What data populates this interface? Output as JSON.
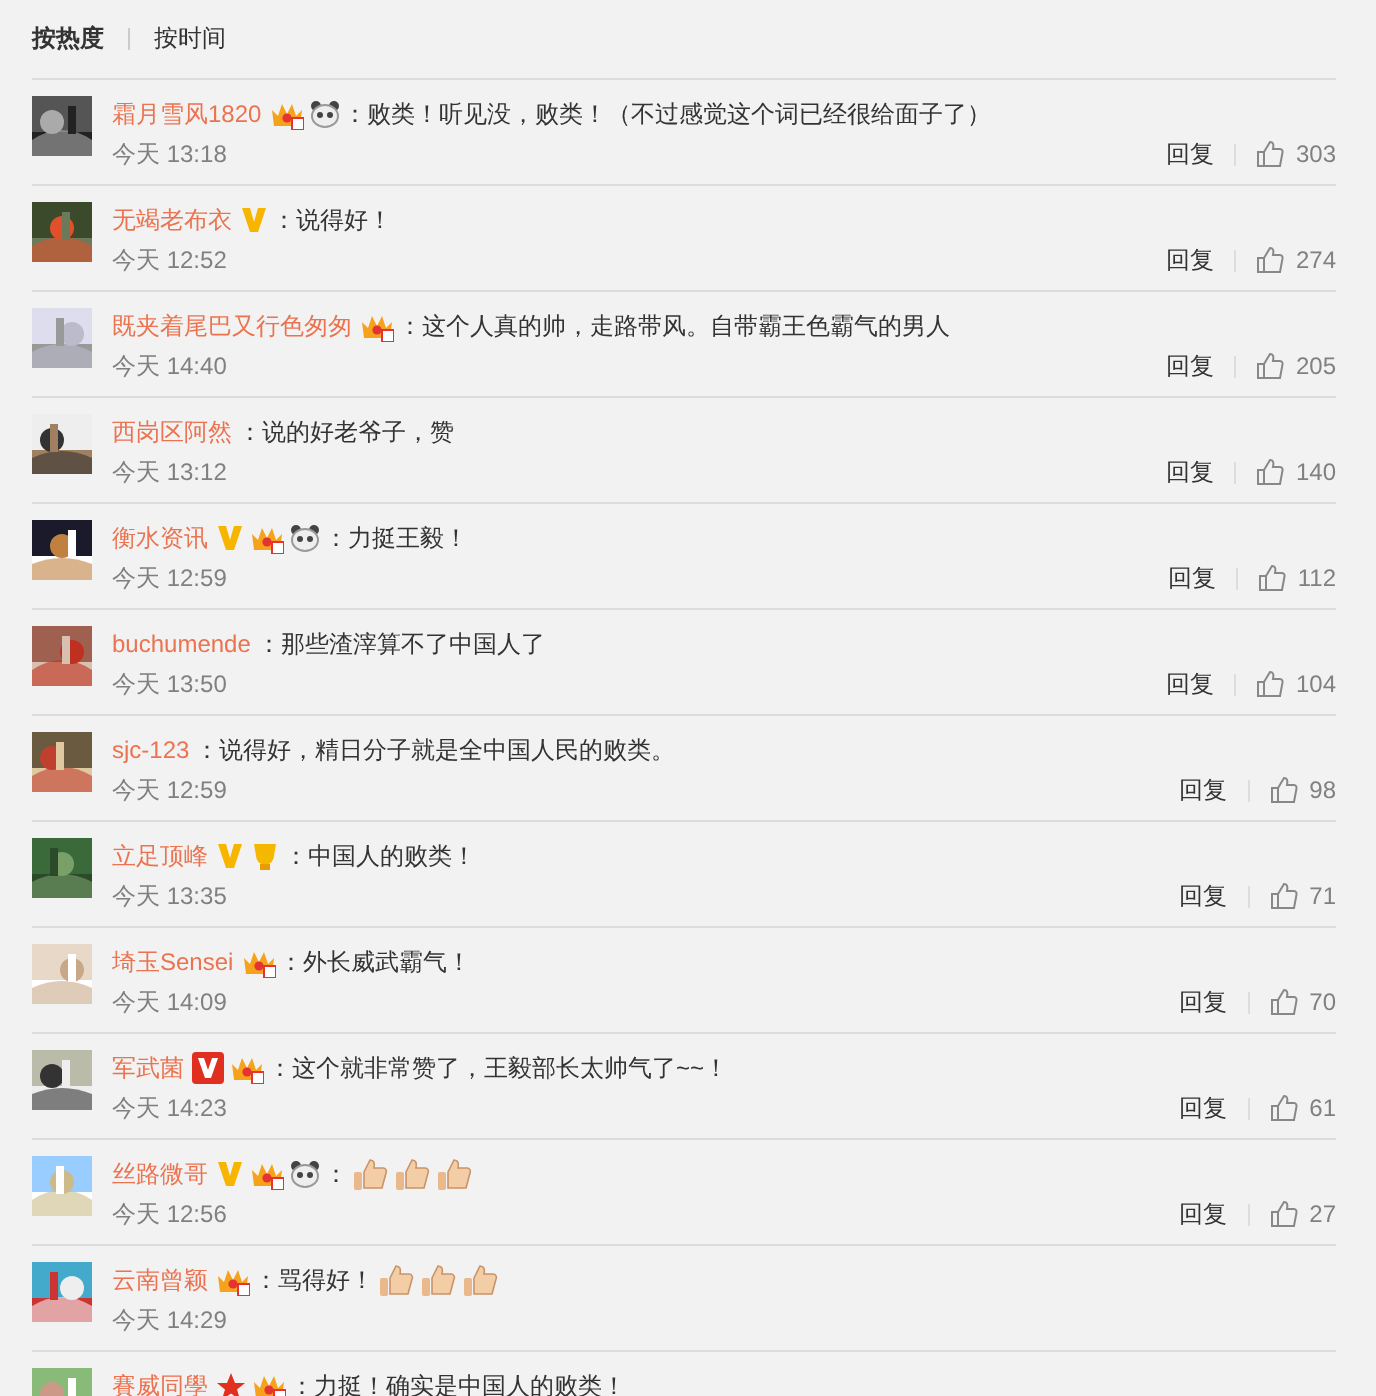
{
  "sort_tabs": [
    {
      "label": "按热度",
      "selected": true
    },
    {
      "label": "按时间",
      "selected": false
    }
  ],
  "comments": [
    {
      "name": "霜月雪风1820",
      "badges": [
        {
          "kind": "crown"
        },
        {
          "kind": "panda"
        }
      ],
      "text": "：败类！听见没，败类！（不过感觉这个词已经很给面子了）",
      "time": "今天 13:18",
      "reply": "回复",
      "likes": "303"
    },
    {
      "name": "无竭老布衣",
      "badges": [
        {
          "kind": "verified"
        }
      ],
      "text": "：说得好！",
      "time": "今天 12:52",
      "reply": "回复",
      "likes": "274"
    },
    {
      "name": "既夹着尾巴又行色匆匆",
      "badges": [
        {
          "kind": "crown"
        }
      ],
      "text": "：这个人真的帅，走路带风。自带霸王色霸气的男人",
      "time": "今天 14:40",
      "reply": "回复",
      "likes": "205"
    },
    {
      "name": "西岗区阿然",
      "text": "：说的好老爷子，赞",
      "time": "今天 13:12",
      "reply": "回复",
      "likes": "140"
    },
    {
      "name": "衡水资讯",
      "badges": [
        {
          "kind": "verified"
        },
        {
          "kind": "crown"
        },
        {
          "kind": "panda"
        }
      ],
      "text": "：力挺王毅！",
      "time": "今天 12:59",
      "reply": "回复",
      "likes": "112"
    },
    {
      "name": "buchumende",
      "text": "：那些渣滓算不了中国人了",
      "time": "今天 13:50",
      "reply": "回复",
      "likes": "104"
    },
    {
      "name": "sjc-123",
      "text": "：说得好，精日分子就是全中国人民的败类。",
      "time": "今天 12:59",
      "reply": "回复",
      "likes": "98"
    },
    {
      "name": "立足顶峰",
      "badges": [
        {
          "kind": "verified"
        },
        {
          "kind": "cup"
        }
      ],
      "text": "：中国人的败类！",
      "time": "今天 13:35",
      "reply": "回复",
      "likes": "71"
    },
    {
      "name": "埼玉Sensei",
      "badges": [
        {
          "kind": "crown"
        }
      ],
      "text": "：外长威武霸气！",
      "time": "今天 14:09",
      "reply": "回复",
      "likes": "70"
    },
    {
      "name": "军武菌",
      "badges": [
        {
          "kind": "verified-red"
        },
        {
          "kind": "crown"
        }
      ],
      "text": "：这个就非常赞了，王毅部长太帅气了~~！",
      "time": "今天 14:23",
      "reply": "回复",
      "likes": "61"
    },
    {
      "name": "丝路微哥",
      "badges": [
        {
          "kind": "verified"
        },
        {
          "kind": "crown"
        },
        {
          "kind": "panda"
        }
      ],
      "text": "：",
      "emojis": [
        {
          "kind": "thumbs-up"
        },
        {
          "kind": "thumbs-up"
        },
        {
          "kind": "thumbs-up"
        }
      ],
      "time": "今天 12:56",
      "reply": "回复",
      "likes": "27"
    },
    {
      "name": "云南曾颖",
      "badges": [
        {
          "kind": "crown"
        }
      ],
      "text": "：骂得好！",
      "emojis": [
        {
          "kind": "thumbs-up"
        },
        {
          "kind": "thumbs-up"
        },
        {
          "kind": "thumbs-up"
        }
      ],
      "time": "今天 14:29"
    },
    {
      "name": "賽威同學",
      "badges": [
        {
          "kind": "star"
        },
        {
          "kind": "crown"
        }
      ],
      "text": "：力挺！确实是中国人的败类！"
    }
  ]
}
